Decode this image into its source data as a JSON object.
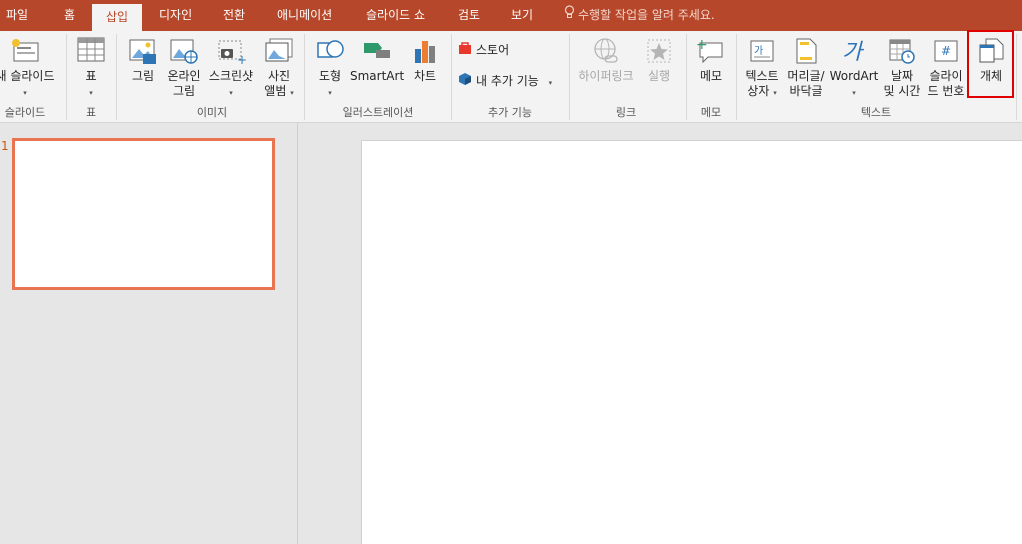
{
  "tabs": [
    "파일",
    "홈",
    "삽입",
    "디자인",
    "전환",
    "애니메이션",
    "슬라이드 쇼",
    "검토",
    "보기"
  ],
  "active_tab": "삽입",
  "tell_me": "수행할 작업을 알려 주세요.",
  "ribbon": {
    "new_slide": "새 슬라이드",
    "table": "표",
    "picture": "그림",
    "online_picture_1": "온라인",
    "online_picture_2": "그림",
    "screenshot": "스크린샷",
    "photo_album_1": "사진",
    "photo_album_2": "앨범",
    "shapes": "도형",
    "smartart": "SmartArt",
    "chart": "차트",
    "store": "스토어",
    "my_addins": "내 추가 기능",
    "hyperlink": "하이퍼링크",
    "action": "실행",
    "comment": "메모",
    "textbox_1": "텍스트",
    "textbox_2": "상자",
    "header_footer_1": "머리글/",
    "header_footer_2": "바닥글",
    "wordart": "WordArt",
    "date_time_1": "날짜",
    "date_time_2": "및 시간",
    "slide_number_1": "슬라이",
    "slide_number_2": "드 번호",
    "object": "개체",
    "caret": "▾"
  },
  "groups": {
    "slides": "슬라이드",
    "tables": "표",
    "images": "이미지",
    "illustrations": "일러스트레이션",
    "addins": "추가 기능",
    "links": "링크",
    "comments": "메모",
    "text": "텍스트"
  },
  "slide_number": "1",
  "colors": {
    "accent": "#b7472a",
    "highlight": "#e00000",
    "thumb_border": "#e97451"
  }
}
